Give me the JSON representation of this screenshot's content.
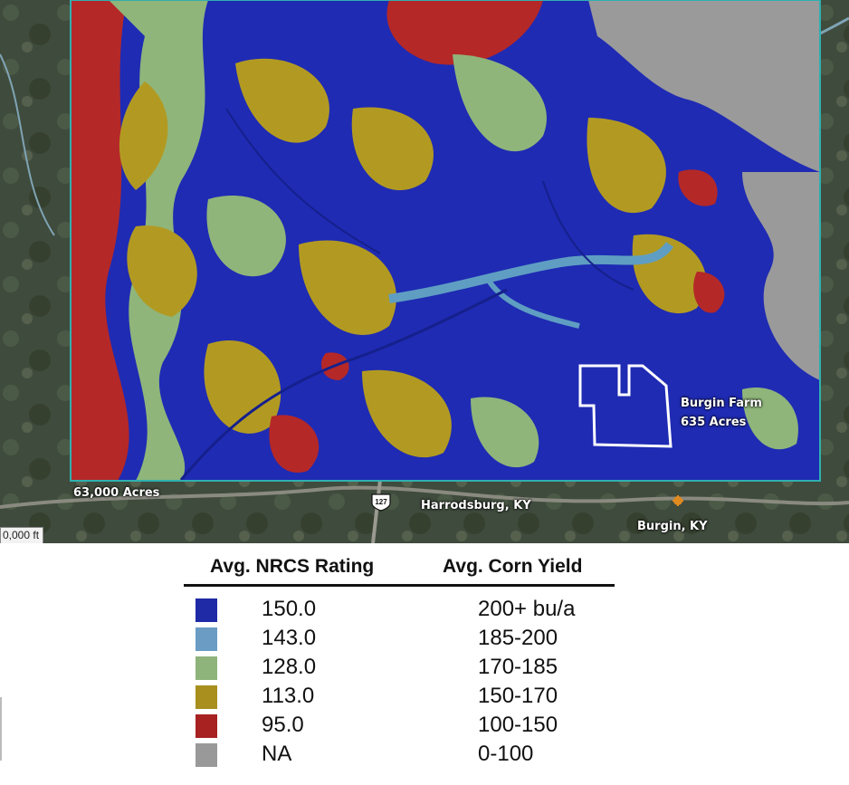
{
  "map": {
    "area_label": "63,000 Acres",
    "farm_label": {
      "line1": "Burgin Farm",
      "line2": "635 Acres"
    },
    "place_labels": [
      "Harrodsburg, KY",
      "Burgin, KY"
    ],
    "scale_label": "0,000 ft",
    "highway_shield": "127",
    "colors": {
      "c150": "#1f2bb3",
      "c143": "#5f9ec2",
      "c128": "#8fb57a",
      "c113": "#b29a22",
      "c95": "#b52828",
      "cNA": "#9a9a9a",
      "study_boundary": "#2fb0b0",
      "farm_boundary": "#ffffff",
      "aerial_background": "#3e4a3c"
    }
  },
  "legend": {
    "header_rating": "Avg. NRCS Rating",
    "header_yield": "Avg. Corn Yield",
    "rows": [
      {
        "rating": "150.0",
        "yield": "200+ bu/a",
        "color": "#1f2aa6"
      },
      {
        "rating": "143.0",
        "yield": "185-200",
        "color": "#6a9cc4"
      },
      {
        "rating": "128.0",
        "yield": "170-185",
        "color": "#8eb47c"
      },
      {
        "rating": "113.0",
        "yield": "150-170",
        "color": "#a88f1e"
      },
      {
        "rating": "95.0",
        "yield": "100-150",
        "color": "#a82222"
      },
      {
        "rating": "NA",
        "yield": "0-100",
        "color": "#999999"
      }
    ]
  }
}
